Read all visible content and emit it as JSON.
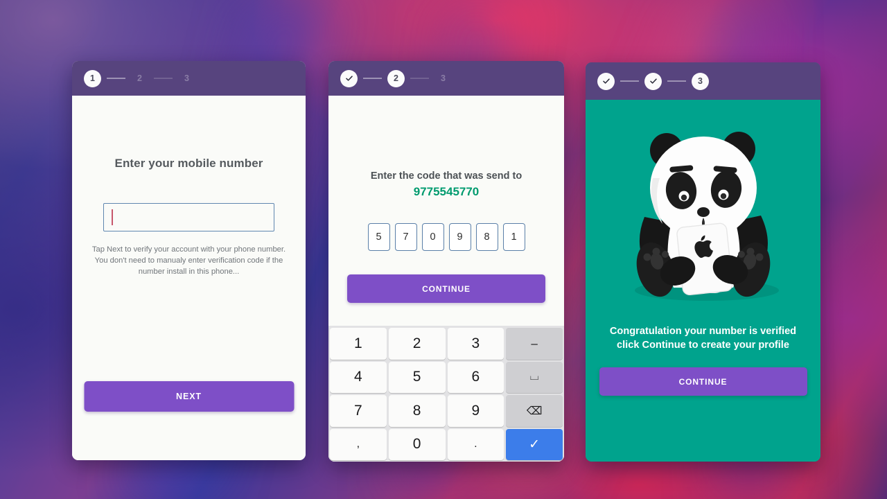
{
  "background": {
    "accent_red": "#f8385c",
    "accent_purple": "#5a3f93",
    "accent_blue": "#3a3cb4",
    "accent_magenta": "#a8305f"
  },
  "theme": {
    "header_purple": "#57447e",
    "button_purple": "#7e4fc7",
    "success_teal": "#00a38d",
    "phone_number_green": "#009b6f",
    "enter_key_blue": "#3c7dea",
    "input_border": "#5f86b0",
    "caret_color": "#c7566b"
  },
  "screens": [
    {
      "id": "enter-mobile-number",
      "stepper": {
        "steps": [
          {
            "label": "1",
            "state": "active",
            "icon": null
          },
          {
            "label": "2",
            "state": "inactive",
            "icon": null
          },
          {
            "label": "3",
            "state": "inactive",
            "icon": null
          }
        ]
      },
      "title": "Enter your mobile number",
      "input": {
        "value": "",
        "placeholder": ""
      },
      "hint": "Tap Next to verify your account with your phone number. You don't need to manualy enter verification code if the number install in this phone...",
      "primary_button": "NEXT"
    },
    {
      "id": "enter-verification-code",
      "stepper": {
        "steps": [
          {
            "label": "",
            "state": "complete",
            "icon": "check-icon"
          },
          {
            "label": "2",
            "state": "active",
            "icon": null
          },
          {
            "label": "3",
            "state": "inactive",
            "icon": null
          }
        ]
      },
      "title": "Enter the code that was send to",
      "phone_number": "9775545770",
      "otp_digits": [
        "5",
        "7",
        "0",
        "9",
        "8",
        "1"
      ],
      "primary_button": "CONTINUE",
      "keypad": {
        "keys": [
          {
            "label": "1",
            "type": "digit",
            "name": "key-1"
          },
          {
            "label": "2",
            "type": "digit",
            "name": "key-2"
          },
          {
            "label": "3",
            "type": "digit",
            "name": "key-3"
          },
          {
            "label": "–",
            "type": "function",
            "name": "key-minus"
          },
          {
            "label": "4",
            "type": "digit",
            "name": "key-4"
          },
          {
            "label": "5",
            "type": "digit",
            "name": "key-5"
          },
          {
            "label": "6",
            "type": "digit",
            "name": "key-6"
          },
          {
            "label": "⌴",
            "type": "function",
            "name": "key-space"
          },
          {
            "label": "7",
            "type": "digit",
            "name": "key-7"
          },
          {
            "label": "8",
            "type": "digit",
            "name": "key-8"
          },
          {
            "label": "9",
            "type": "digit",
            "name": "key-9"
          },
          {
            "label": "⌫",
            "type": "function",
            "name": "key-backspace"
          },
          {
            "label": ",",
            "type": "digit",
            "name": "key-comma"
          },
          {
            "label": "0",
            "type": "digit",
            "name": "key-0"
          },
          {
            "label": ".",
            "type": "digit",
            "name": "key-period"
          },
          {
            "label": "✓",
            "type": "enter",
            "name": "key-enter"
          }
        ]
      }
    },
    {
      "id": "verification-success",
      "stepper": {
        "steps": [
          {
            "label": "",
            "state": "complete",
            "icon": "check-icon"
          },
          {
            "label": "",
            "state": "complete",
            "icon": "check-icon"
          },
          {
            "label": "3",
            "state": "active",
            "icon": null
          }
        ]
      },
      "illustration": "panda-holding-phone-illustration",
      "message": "Congratulation your number is verified click Continue to create your profile",
      "primary_button": "CONTINUE"
    }
  ]
}
